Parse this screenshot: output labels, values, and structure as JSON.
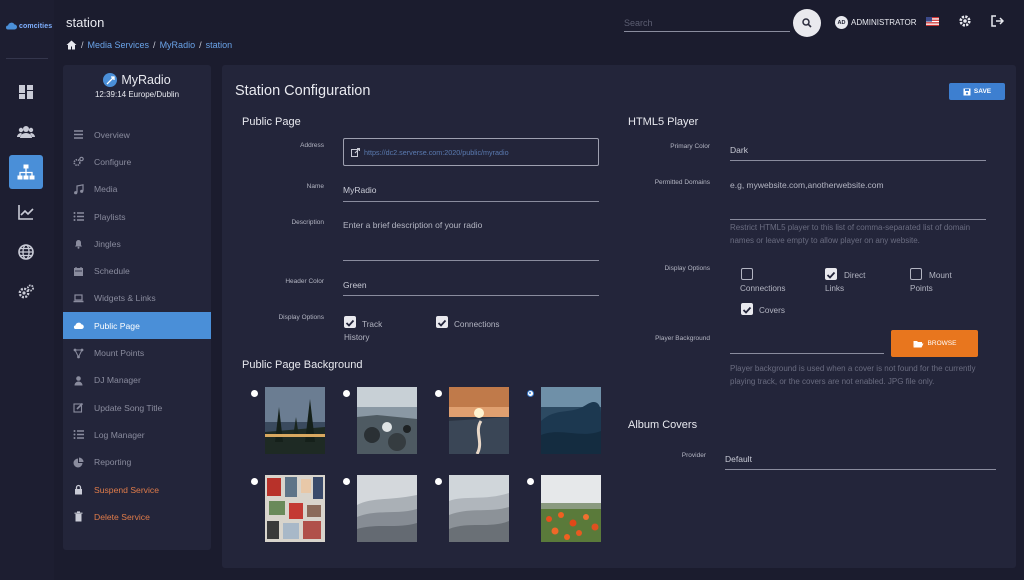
{
  "app": {
    "logo_text": "comcities"
  },
  "header": {
    "title": "station",
    "breadcrumb": [
      "Media Services",
      "MyRadio",
      "station"
    ],
    "search_placeholder": "Search",
    "user_initials": "AD",
    "user_name": "ADMINISTRATOR"
  },
  "rail": {
    "items": [
      {
        "icon": "dashboard-icon"
      },
      {
        "icon": "users-icon"
      },
      {
        "icon": "sitemap-icon",
        "active": true
      },
      {
        "icon": "chart-icon"
      },
      {
        "icon": "globe-icon"
      },
      {
        "icon": "gears-icon"
      }
    ]
  },
  "station": {
    "name": "MyRadio",
    "time": "12:39:14 Europe/Dublin"
  },
  "nav": [
    {
      "label": "Overview",
      "icon": "list-icon"
    },
    {
      "label": "Configure",
      "icon": "cogs-icon"
    },
    {
      "label": "Media",
      "icon": "music-icon"
    },
    {
      "label": "Playlists",
      "icon": "list-icon"
    },
    {
      "label": "Jingles",
      "icon": "bell-icon"
    },
    {
      "label": "Schedule",
      "icon": "calendar-icon"
    },
    {
      "label": "Widgets & Links",
      "icon": "laptop-icon"
    },
    {
      "label": "Public Page",
      "icon": "cloud-icon",
      "active": true
    },
    {
      "label": "Mount Points",
      "icon": "nodes-icon"
    },
    {
      "label": "DJ Manager",
      "icon": "user-icon"
    },
    {
      "label": "Update Song Title",
      "icon": "edit-icon"
    },
    {
      "label": "Log Manager",
      "icon": "list-icon"
    },
    {
      "label": "Reporting",
      "icon": "pie-icon"
    },
    {
      "label": "Suspend Service",
      "icon": "lock-icon",
      "danger": true
    },
    {
      "label": "Delete Service",
      "icon": "trash-icon",
      "danger": true
    }
  ],
  "main": {
    "title": "Station Configuration",
    "save_label": "SAVE",
    "public_page": {
      "heading": "Public Page",
      "address_label": "Address",
      "address_value": "https://dc2.serverse.com:2020/public/myradio",
      "name_label": "Name",
      "name_value": "MyRadio",
      "description_label": "Description",
      "description_placeholder": "Enter a brief description of your radio",
      "header_color_label": "Header Color",
      "header_color_value": "Green",
      "display_options_label": "Display Options",
      "opt_track_history": "Track History",
      "opt_connections": "Connections"
    },
    "background": {
      "heading": "Public Page Background",
      "selected_index": 3
    },
    "html5": {
      "heading": "HTML5 Player",
      "primary_color_label": "Primary Color",
      "primary_color_value": "Dark",
      "permitted_domains_label": "Permitted Domains",
      "permitted_domains_placeholder": "e.g, mywebsite.com,anotherwebsite.com",
      "permitted_help": "Restrict HTML5 player to this list of comma-separated list of domain names or leave empty to allow player on any website.",
      "display_options_label": "Display Options",
      "opt_connections": "Connections",
      "opt_direct_links": "Direct Links",
      "opt_mount_points": "Mount Points",
      "opt_covers": "Covers",
      "player_bg_label": "Player Background",
      "browse_label": "BROWSE",
      "player_bg_help": "Player background is used when a cover is not found for the currently playing track, or the covers are not enabled. JPG file only."
    },
    "album": {
      "heading": "Album Covers",
      "provider_label": "Provider",
      "provider_value": "Default"
    }
  },
  "colors": {
    "accent": "#4a8fd8",
    "orange": "#e8761e",
    "danger": "#e07c4a"
  }
}
